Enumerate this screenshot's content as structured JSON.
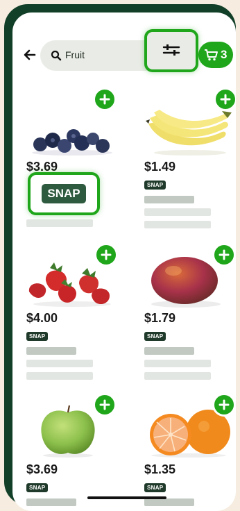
{
  "search": {
    "query": "Fruit"
  },
  "cart": {
    "count": "3"
  },
  "products": [
    {
      "name": "blueberries",
      "price": "$3.69",
      "snap": "SNAP"
    },
    {
      "name": "bananas",
      "price": "$1.49",
      "snap": "SNAP"
    },
    {
      "name": "strawberries",
      "price": "$4.00",
      "snap": "SNAP"
    },
    {
      "name": "mango",
      "price": "$1.79",
      "snap": "SNAP"
    },
    {
      "name": "green-apple",
      "price": "$3.69",
      "snap": "SNAP"
    },
    {
      "name": "oranges",
      "price": "$1.35",
      "snap": "SNAP"
    }
  ],
  "highlight": {
    "snap_label": "SNAP"
  },
  "colors": {
    "accent": "#1fa61a",
    "frame": "#123f28",
    "snap_badge": "#1f3a2a"
  },
  "icons": [
    "back-arrow-icon",
    "search-icon",
    "filter-sliders-icon",
    "cart-icon",
    "plus-icon"
  ]
}
